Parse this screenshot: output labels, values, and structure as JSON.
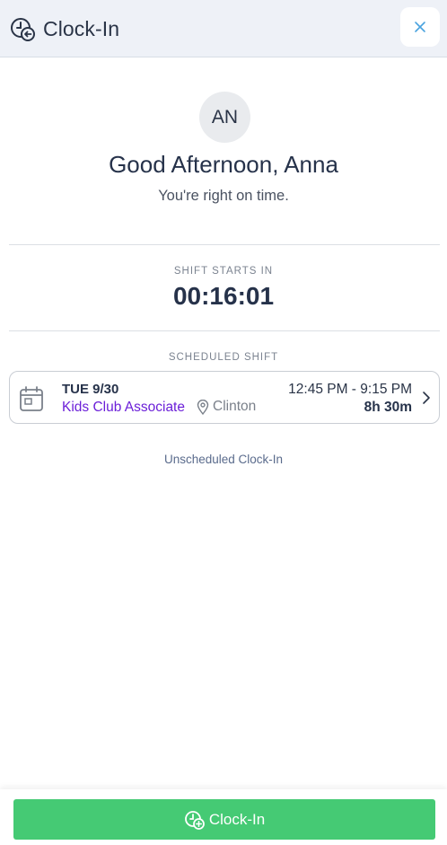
{
  "header": {
    "title": "Clock-In",
    "title_icon": "clock-arrow-icon",
    "close_icon": "close-icon"
  },
  "profile": {
    "initials": "AN",
    "greeting": "Good Afternoon, Anna",
    "status_message": "You're right on time."
  },
  "countdown": {
    "label": "SHIFT STARTS IN",
    "value": "00:16:01"
  },
  "scheduled_shift": {
    "label": "SCHEDULED SHIFT",
    "date": "TUE 9/30",
    "role": "Kids Club Associate",
    "location": "Clinton",
    "time_range": "12:45 PM - 9:15 PM",
    "duration": "8h 30m",
    "icons": {
      "calendar": "calendar-icon",
      "location": "map-pin-icon",
      "chevron": "chevron-right-icon"
    }
  },
  "unscheduled_link": "Unscheduled Clock-In",
  "footer": {
    "button_label": "Clock-In",
    "button_icon": "clock-plus-icon"
  },
  "colors": {
    "header_bg": "#eef1f7",
    "accent_green": "#45ca74",
    "role_purple": "#6b1fd8",
    "close_icon_blue": "#4aa3df",
    "text_dark": "#26324a"
  }
}
